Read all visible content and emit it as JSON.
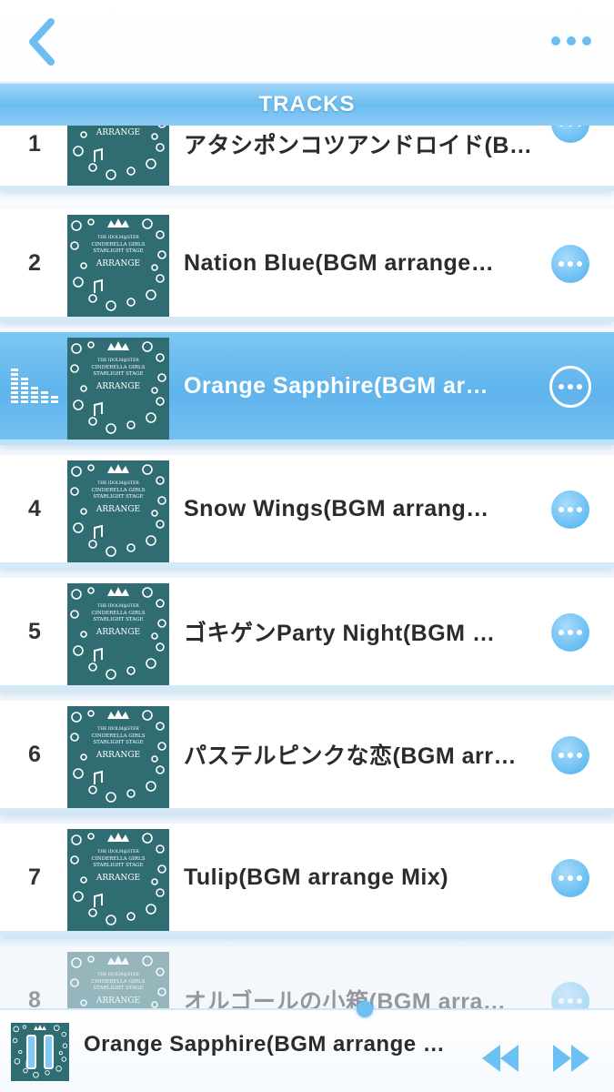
{
  "header": {
    "section_title": "TRACKS"
  },
  "colors": {
    "accent": "#6cbcf0",
    "art_bg": "#2f6d72",
    "active_row": "#5fb4ec"
  },
  "album_art": {
    "line1": "THE IDOLM@STER",
    "line2": "CINDERELLA GIRLS",
    "line3": "STARLIGHT STAGE",
    "label": "ARRANGE"
  },
  "tracks": [
    {
      "number": "1",
      "title": "アタシポンコツアンドロイド(B…"
    },
    {
      "number": "2",
      "title": "Nation  Blue(BGM  arrange…"
    },
    {
      "number": "",
      "title": "Orange  Sapphire(BGM  ar…"
    },
    {
      "number": "4",
      "title": "Snow  Wings(BGM  arrang…"
    },
    {
      "number": "5",
      "title": "ゴキゲンParty  Night(BGM  …"
    },
    {
      "number": "6",
      "title": "パステルピンクな恋(BGM  arr…"
    },
    {
      "number": "7",
      "title": "Tulip(BGM  arrange  Mix)"
    },
    {
      "number": "8",
      "title": "オルゴールの小箱(BGM  arra…"
    }
  ],
  "player": {
    "now_playing": "Orange  Sapphire(BGM  arrange  …"
  }
}
